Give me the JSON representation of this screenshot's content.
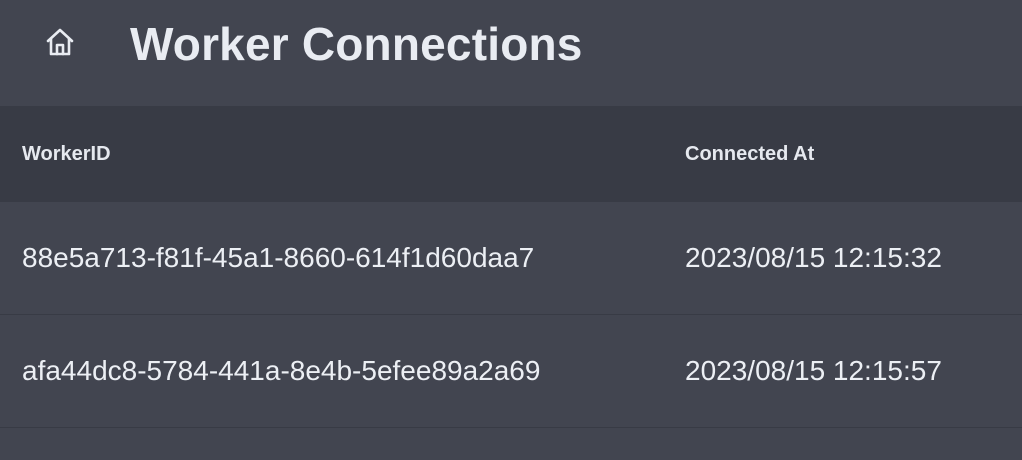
{
  "header": {
    "home_icon": "home-icon",
    "title": "Worker Connections"
  },
  "table": {
    "columns": [
      "WorkerID",
      "Connected At"
    ],
    "rows": [
      {
        "worker_id": "88e5a713-f81f-45a1-8660-614f1d60daa7",
        "connected_at": "2023/08/15 12:15:32"
      },
      {
        "worker_id": "afa44dc8-5784-441a-8e4b-5efee89a2a69",
        "connected_at": "2023/08/15 12:15:57"
      }
    ]
  }
}
